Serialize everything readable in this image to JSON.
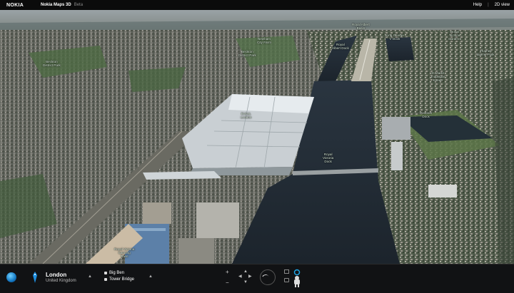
{
  "header": {
    "brand": "NOKIA",
    "app_name": "Nokia Maps 3D",
    "app_tag": "Beta",
    "help": "Help",
    "separator": "|",
    "view_2d": "2D view"
  },
  "map": {
    "labels": [
      {
        "id": "beckton-district-park",
        "text": "Beckton\nDistrict Park"
      },
      {
        "id": "newham-city-farm",
        "text": "Newham\nCity Farm"
      },
      {
        "id": "royal-albert-basin",
        "text": "Royal Albert\nBasin"
      },
      {
        "id": "beckton-district-park-s",
        "text": "Beckton\nDistrict Park"
      },
      {
        "id": "king-george-v-dock",
        "text": "King George\nV Dock"
      },
      {
        "id": "royal-albert-dock",
        "text": "Royal\nAlbert Dock"
      },
      {
        "id": "royal-victoria-gardens",
        "text": "Royal\nVictoria\nGardens"
      },
      {
        "id": "thames-barrier-park",
        "text": "Thames\nBarrier Park"
      },
      {
        "id": "st-marks-industrial-estate",
        "text": "St Marks\nIndustrial\nEstate"
      },
      {
        "id": "excel",
        "text": "ExCeL\nLondon"
      },
      {
        "id": "pontoon-dock",
        "text": "Pontoon\nDock"
      },
      {
        "id": "royal-victoria-dock",
        "text": "Royal\nVictoria\nDock"
      },
      {
        "id": "royal-victoria-canning",
        "text": "Royal Victoria\nCanning\nTown"
      }
    ]
  },
  "footer": {
    "city": "London",
    "country": "United Kingdom",
    "poi_1": "Big Ben",
    "poi_2": "Tower Bridge",
    "zoom_in": "+",
    "zoom_out": "−"
  }
}
